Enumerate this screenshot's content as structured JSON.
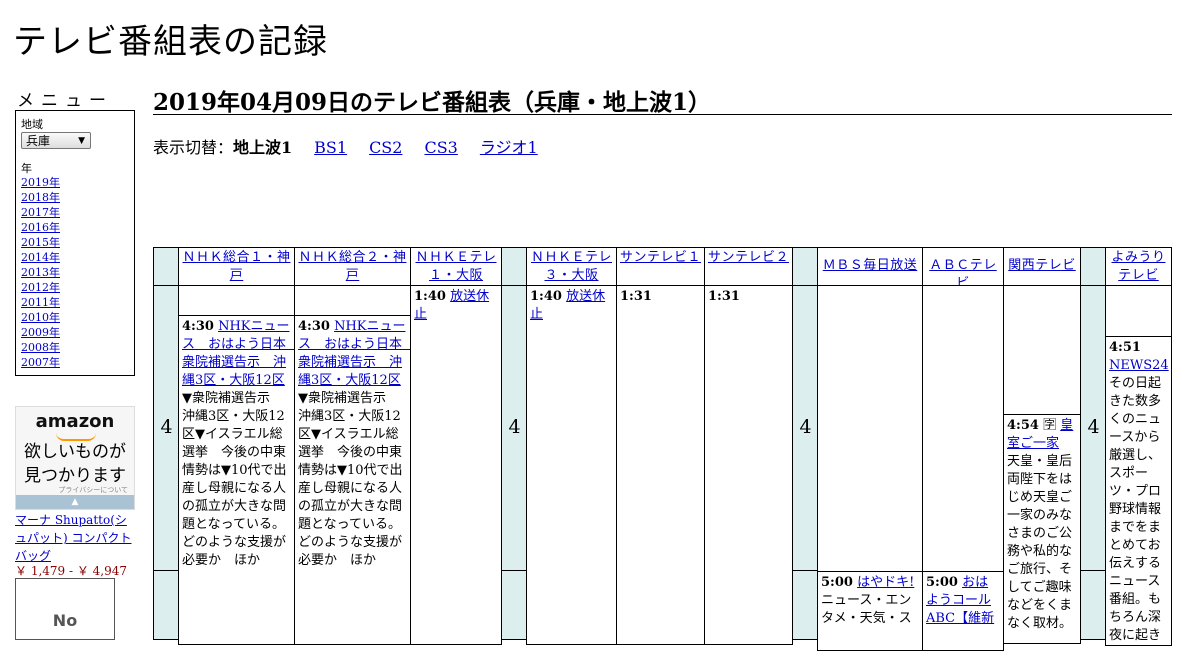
{
  "site": {
    "title": "テレビ番組表の記録"
  },
  "menu": {
    "title": "メニュー",
    "region_label": "地域",
    "region_value": "兵庫",
    "year_label": "年",
    "years": [
      "2019年",
      "2018年",
      "2017年",
      "2016年",
      "2015年",
      "2014年",
      "2013年",
      "2012年",
      "2011年",
      "2010年",
      "2009年",
      "2008年",
      "2007年"
    ]
  },
  "ad": {
    "brand": "amazon",
    "line1": "欲しいものが",
    "line2": "見つかります",
    "privacy": "プライバシーについて",
    "product_name": "マーナ Shupatto(シュパット) コンパクトバッグ",
    "product_price": "￥ 1,479 - ￥ 4,947",
    "no_image_text": "No"
  },
  "page": {
    "title": "2019年04月09日のテレビ番組表（兵庫・地上波1）",
    "switch_label": "表示切替：",
    "current": "地上波1",
    "links": [
      "BS1",
      "CS2",
      "CS3",
      "ラジオ1"
    ]
  },
  "grid": {
    "hour": "4",
    "channels": [
      "ＮＨＫ総合１・神戸",
      "ＮＨＫ総合２・神戸",
      "ＮＨＫＥテレ１・大阪",
      "ＮＨＫＥテレ３・大阪",
      "サンテレビ１",
      "サンテレビ２",
      "ＭＢＳ毎日放送",
      "ＡＢＣテレビ",
      "関西テレビ",
      "よみうりテレビ"
    ],
    "programs": {
      "nhk1_0430": {
        "time": "4:30",
        "title": "NHKニュース　おはよう日本　衆院補選告示　沖縄3区・大阪12区",
        "desc": "▼衆院補選告示　沖縄3区・大阪12区▼イスラエル総選挙　今後の中東情勢は▼10代で出産し母親になる人の孤立が大きな問題となっている。どのような支援が必要か　ほか"
      },
      "nhk2_0430": {
        "time": "4:30",
        "title": "NHKニュース　おはよう日本　衆院補選告示　沖縄3区・大阪12区",
        "desc": "▼衆院補選告示　沖縄3区・大阪12区▼イスラエル総選挙　今後の中東情勢は▼10代で出産し母親になる人の孤立が大きな問題となっている。どのような支援が必要か　ほか"
      },
      "etele1_0140": {
        "time": "1:40",
        "title": "放送休止"
      },
      "etele3_0140": {
        "time": "1:40",
        "title": "放送休止"
      },
      "sun1_0131": {
        "time": "1:31"
      },
      "sun2_0131": {
        "time": "1:31"
      },
      "mbs_0500": {
        "time": "5:00",
        "title": "はやドキ!",
        "desc": "ニュース・エンタメ・天気・ス"
      },
      "abc_0500": {
        "time": "5:00",
        "title": "おはようコール ABC【維新",
        "desc": ""
      },
      "ktv_0454": {
        "time": "4:54",
        "mark": "🈑",
        "title": "皇室ご一家",
        "desc": "天皇・皇后両陛下をはじめ天皇ご一家のみなさまのご公務や私的なご旅行、そしてご趣味などをくまなく取材。"
      },
      "ytv_0451": {
        "time": "4:51",
        "title": "NEWS24",
        "desc": "その日起きた数多くのニュースから厳選し、スポーツ・プロ野球情報までをまとめてお伝えするニュース番組。もちろん深夜に起きた"
      }
    }
  }
}
